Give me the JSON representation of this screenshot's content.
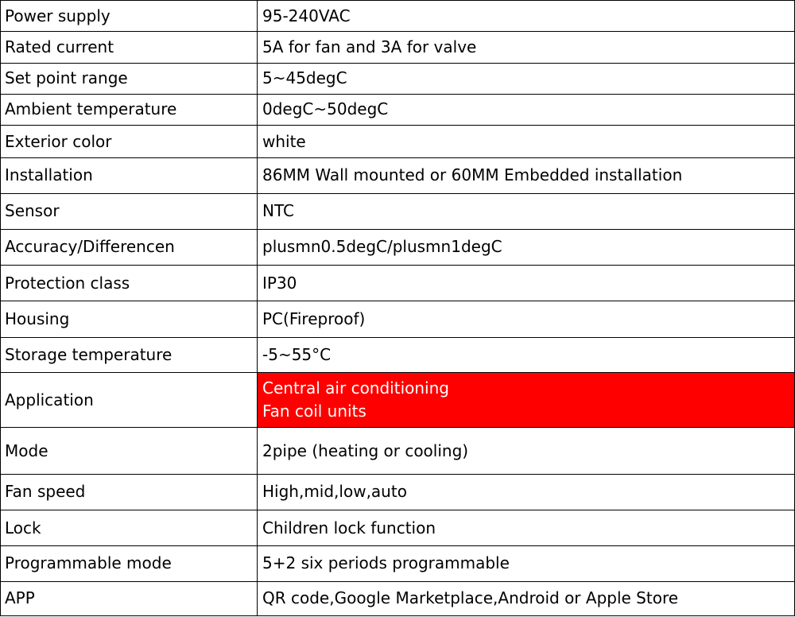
{
  "spec_table": {
    "rows": [
      {
        "label": "Power supply",
        "value": "95-240VAC"
      },
      {
        "label": "Rated current",
        "value": "5A for fan and 3A for valve"
      },
      {
        "label": "Set point range",
        "value": "5~45degC"
      },
      {
        "label": "Ambient temperature",
        "value": "0degC~50degC"
      },
      {
        "label": "Exterior color",
        "value": "white"
      },
      {
        "label": "Installation",
        "value": "86MM Wall mounted or 60MM Embedded installation"
      },
      {
        "label": "Sensor",
        "value": "NTC"
      },
      {
        "label": "Accuracy/Differencen",
        "value": "plusmn0.5degC/plusmn1degC"
      },
      {
        "label": "Protection class",
        "value": "IP30"
      },
      {
        "label": "Housing",
        "value": "PC(Fireproof)"
      },
      {
        "label": "Storage temperature",
        "value": "-5~55°C"
      },
      {
        "label": "Application",
        "value_lines": [
          "Central air conditioning",
          "Fan coil units"
        ]
      },
      {
        "label": "Mode",
        "value": "2pipe (heating or cooling)"
      },
      {
        "label": "Fan speed",
        "value": "High,mid,low,auto"
      },
      {
        "label": "Lock",
        "value": "Children  lock function"
      },
      {
        "label": "Programmable mode",
        "value": "5+2 six periods programmable"
      },
      {
        "label": "APP",
        "value": "QR  code,Google Marketplace,Android or Apple Store"
      }
    ]
  },
  "colors": {
    "highlight_background": "#ff0000",
    "highlight_text": "#ffffff",
    "border": "#000000"
  }
}
